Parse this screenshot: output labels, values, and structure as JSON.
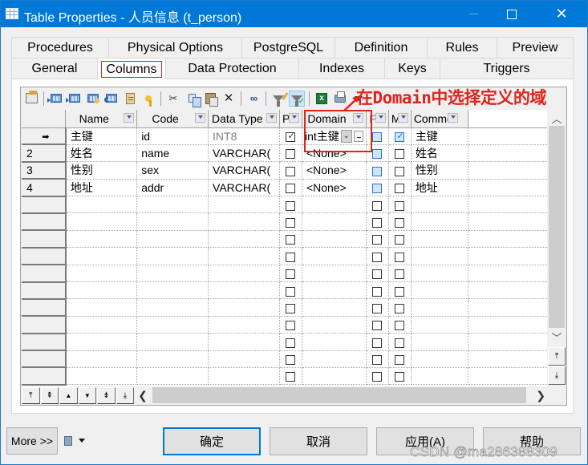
{
  "window": {
    "title": "Table Properties - 人员信息 (t_person)",
    "icon": "table-icon",
    "controls": {
      "minimize": "minimize-icon",
      "maximize": "maximize-icon",
      "close": "✕"
    }
  },
  "tabs": {
    "row1": [
      "Procedures",
      "Physical Options",
      "PostgreSQL",
      "Definition",
      "Rules",
      "Preview"
    ],
    "row2": [
      "General",
      "Columns",
      "Data Protection",
      "Indexes",
      "Keys",
      "Triggers"
    ],
    "active": "Columns"
  },
  "toolbar": {
    "buttons": [
      "properties-icon",
      "insert-row-icon",
      "add-row-icon",
      "add-columns-icon",
      "reuse-columns-icon",
      "add-data-item-icon",
      "key-icon",
      "cut-icon",
      "copy-icon",
      "paste-icon",
      "delete-icon",
      "find-icon",
      "customize-filter-icon",
      "enable-filter-icon",
      "export-excel-icon",
      "print-icon",
      "more-dropdown-icon"
    ],
    "delete_glyph": "✕",
    "find_glyph": "🔭"
  },
  "annotation": {
    "text": "在Domain中选择定义的域",
    "color": "#e0231b"
  },
  "grid": {
    "columns": [
      {
        "key": "rownum",
        "label": ""
      },
      {
        "key": "name",
        "label": "Name"
      },
      {
        "key": "code",
        "label": "Code"
      },
      {
        "key": "datatype",
        "label": "Data Type"
      },
      {
        "key": "p",
        "label": "P"
      },
      {
        "key": "domain",
        "label": "Domain"
      },
      {
        "key": "f",
        "label": "F"
      },
      {
        "key": "m",
        "label": "M"
      },
      {
        "key": "comment",
        "label": "Comme"
      }
    ],
    "rows": [
      {
        "marker": "➡",
        "name": "主键",
        "code": "id",
        "datatype": "INT8",
        "datatype_muted": true,
        "p": true,
        "domain": "int主键",
        "domain_editing": true,
        "f": false,
        "m": true,
        "comment": "主键"
      },
      {
        "marker": "2",
        "name": "姓名",
        "code": "name",
        "datatype": "VARCHAR(",
        "p": false,
        "domain": "<None>",
        "f": false,
        "m": false,
        "comment": "姓名"
      },
      {
        "marker": "3",
        "name": "性别",
        "code": "sex",
        "datatype": "VARCHAR(",
        "p": false,
        "domain": "<None>",
        "f": false,
        "m": false,
        "comment": "性别"
      },
      {
        "marker": "4",
        "name": "地址",
        "code": "addr",
        "datatype": "VARCHAR(",
        "p": false,
        "domain": "<None>",
        "f": false,
        "m": false,
        "comment": "地址"
      }
    ],
    "empty_rows": 11,
    "domain_dropdown_glyph": "⌄"
  },
  "navigation": {
    "buttons": [
      {
        "name": "move-to-top",
        "glyph": "⤒"
      },
      {
        "name": "move-page-up",
        "glyph": "⇞"
      },
      {
        "name": "move-up",
        "glyph": "▲"
      },
      {
        "name": "move-down",
        "glyph": "▼"
      },
      {
        "name": "move-page-down",
        "glyph": "⇟"
      },
      {
        "name": "move-to-bottom",
        "glyph": "⤓"
      }
    ],
    "hscroll_left": "❮",
    "hscroll_right": "❯",
    "vscroll_up": "︿",
    "vscroll_down": "﹀",
    "jump_top": "⤒",
    "jump_bottom": "⤓"
  },
  "footer": {
    "more": "More >>",
    "ok": "确定",
    "cancel": "取消",
    "apply": "应用(A)",
    "help": "帮助",
    "watermark": "CSDN @ma286388309"
  }
}
